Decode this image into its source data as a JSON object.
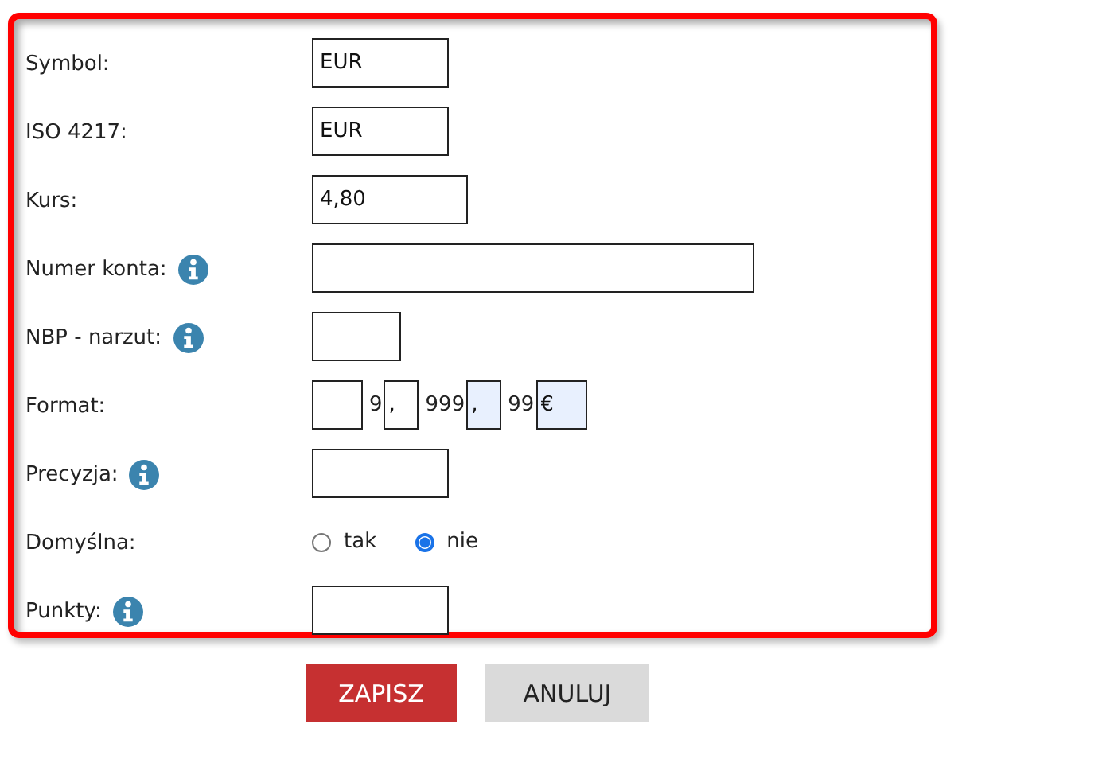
{
  "fields": [
    {
      "kind": "text",
      "label": "Symbol:",
      "info": false,
      "value": "EUR"
    },
    {
      "kind": "text",
      "label": "ISO 4217:",
      "info": false,
      "value": "EUR"
    },
    {
      "kind": "text",
      "label": "Kurs:",
      "info": false,
      "value": "4,80"
    },
    {
      "kind": "text",
      "label": "Numer konta:",
      "info": true
    },
    {
      "kind": "text",
      "label": "NBP - narzut:",
      "info": true
    },
    {
      "kind": "format",
      "label": "Format:",
      "info": false,
      "parts": [
        {
          "kind": "input",
          "highlighted": false
        },
        {
          "kind": "text",
          "value": "9"
        },
        {
          "kind": "input",
          "value": ",",
          "highlighted": false
        },
        {
          "kind": "text",
          "value": "999"
        },
        {
          "kind": "input",
          "value": ",",
          "highlighted": true
        },
        {
          "kind": "text",
          "value": "99"
        },
        {
          "kind": "input",
          "value": "€",
          "highlighted": true
        }
      ]
    },
    {
      "kind": "text",
      "label": "Precyzja:",
      "info": true
    },
    {
      "kind": "radio",
      "label": "Domyślna:",
      "info": false,
      "options": [
        {
          "label": "tak",
          "selected": false
        },
        {
          "label": "nie",
          "selected": true
        }
      ]
    },
    {
      "kind": "text",
      "label": "Punkty:",
      "info": true
    }
  ],
  "buttons": [
    {
      "label": "ZAPISZ",
      "kind": "primary"
    },
    {
      "label": "ANULUJ",
      "kind": "secondary"
    }
  ]
}
